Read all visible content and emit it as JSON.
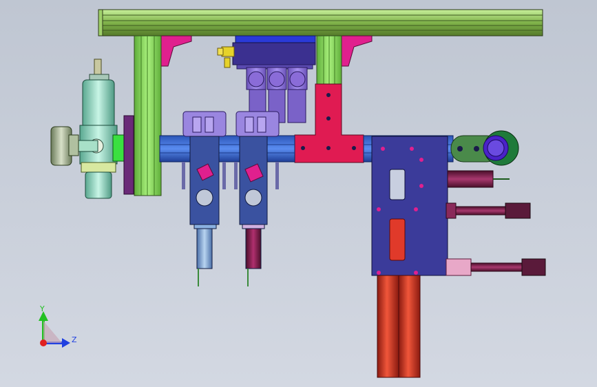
{
  "viewport": {
    "background_top": "#bfc6d2",
    "background_bottom": "#d3d8e2"
  },
  "triad": {
    "y_label": "Y",
    "z_label": "Z",
    "y_color": "#22c022",
    "z_color": "#2040e0",
    "x_color": "#e02020"
  },
  "colors": {
    "profile_green": "#8ee36a",
    "frame_olive": "#7fa04a",
    "bracket_pink": "#e0208e",
    "rail_blue": "#3a6fd8",
    "plate_navy": "#3b3b9a",
    "cylinder_red": "#d8321e",
    "valve_lavender": "#8a6cd8",
    "mount_red": "#e01b52",
    "regulator_teal": "#7fd6b8",
    "rod_maroon": "#7a1b4a"
  }
}
